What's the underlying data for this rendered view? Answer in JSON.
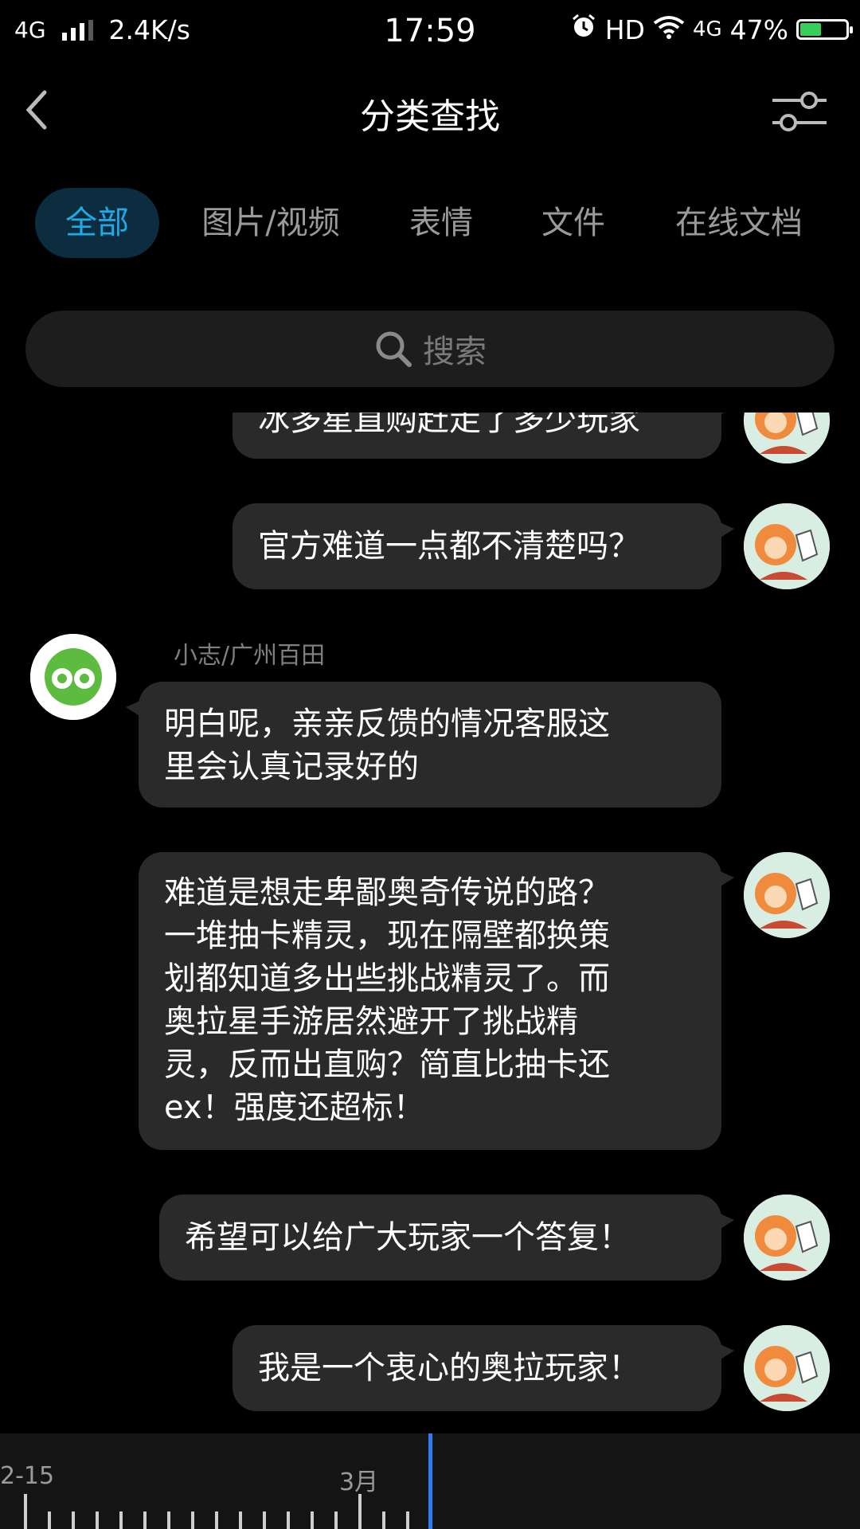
{
  "status_bar": {
    "network": "4G",
    "speed": "2.4K/s",
    "time": "17:59",
    "hd": "HD",
    "network_right": "4G",
    "battery": "47%",
    "battery_level": 0.47
  },
  "header": {
    "title": "分类查找"
  },
  "tabs": [
    {
      "label": "全部",
      "active": true
    },
    {
      "label": "图片/视频",
      "active": false
    },
    {
      "label": "表情",
      "active": false
    },
    {
      "label": "文件",
      "active": false
    },
    {
      "label": "在线文档",
      "active": false
    }
  ],
  "search": {
    "placeholder": "搜索"
  },
  "messages": [
    {
      "side": "right",
      "text": "冰多星直购赶走了多少玩家"
    },
    {
      "side": "right",
      "text": "官方难道一点都不清楚吗？"
    },
    {
      "side": "left",
      "sender": "小志/广州百田",
      "text": "明白呢，亲亲反馈的情况客服这\n里会认真记录好的"
    },
    {
      "side": "right",
      "text": "难道是想走卑鄙奥奇传说的路？\n一堆抽卡精灵，现在隔壁都换策\n划都知道多出些挑战精灵了。而\n奥拉星手游居然避开了挑战精\n灵，反而出直购？简直比抽卡还\nex！强度还超标！"
    },
    {
      "side": "right",
      "text": "希望可以给广大玩家一个答复！"
    },
    {
      "side": "right",
      "text": "我是一个衷心的奥拉玩家！"
    }
  ],
  "timeline": {
    "labels": [
      "2-15",
      "3月"
    ]
  },
  "colors": {
    "accent": "#1fa9e6",
    "bubble": "#2a2a2a",
    "cursor": "#2f7bf0"
  }
}
